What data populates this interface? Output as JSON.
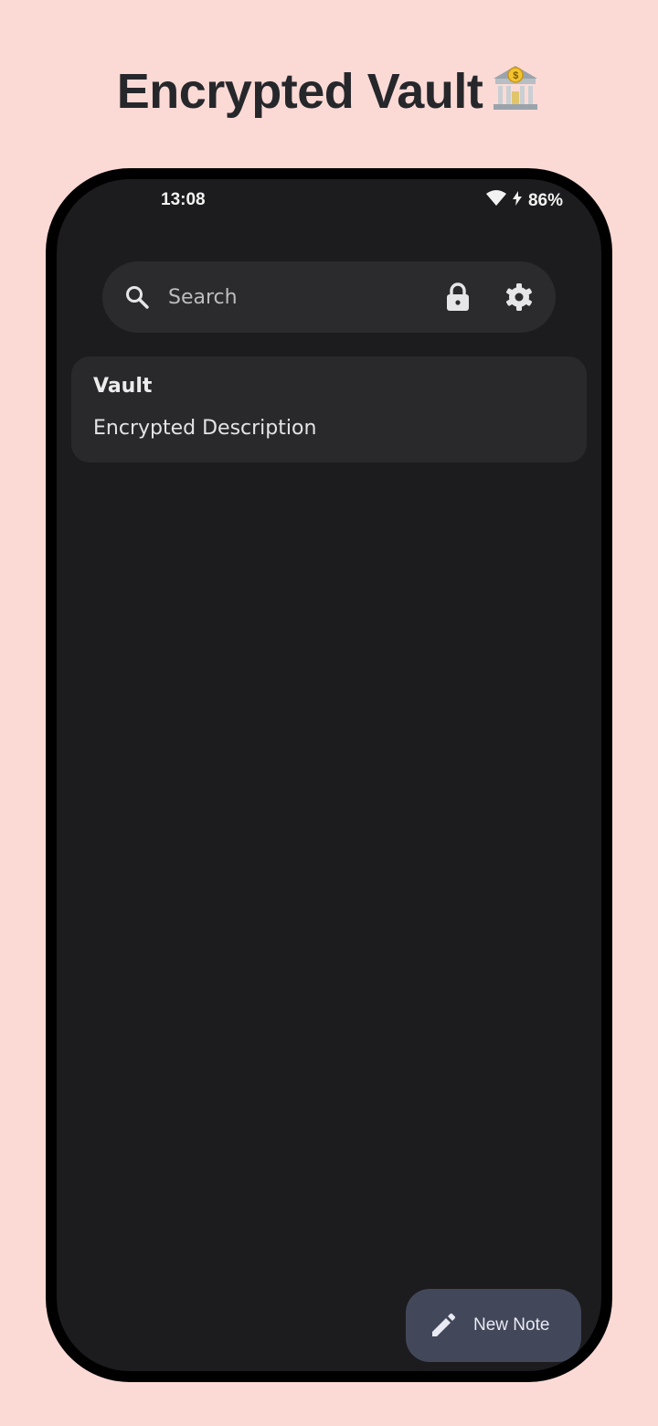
{
  "header": {
    "title": "Encrypted Vault",
    "emoji": "🏦"
  },
  "status_bar": {
    "time": "13:08",
    "battery": "86%"
  },
  "search": {
    "placeholder": "Search"
  },
  "notes": [
    {
      "title": "Vault",
      "description": "Encrypted Description"
    }
  ],
  "fab": {
    "label": "New Note"
  },
  "icons": {
    "search": "search-icon",
    "lock": "lock-icon",
    "settings": "gear-icon",
    "fab": "pencil-icon",
    "wifi": "wifi-icon",
    "charging": "bolt-icon"
  },
  "colors": {
    "background": "#fbdad6",
    "screen": "#1c1c1e",
    "card": "#29292c",
    "searchbar": "#2b2b2e",
    "fab": "#42475a"
  }
}
